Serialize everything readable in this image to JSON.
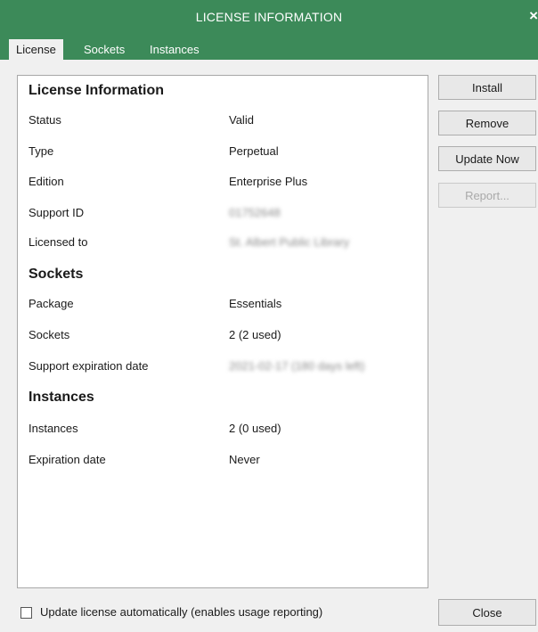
{
  "window": {
    "title": "LICENSE INFORMATION",
    "close_glyph": "×"
  },
  "tabs": [
    {
      "label": "License",
      "active": true
    },
    {
      "label": "Sockets",
      "active": false
    },
    {
      "label": "Instances",
      "active": false
    }
  ],
  "license_info": {
    "heading": "License Information",
    "rows": [
      {
        "label": "Status",
        "value": "Valid"
      },
      {
        "label": "Type",
        "value": "Perpetual"
      },
      {
        "label": "Edition",
        "value": "Enterprise Plus"
      },
      {
        "label": "Support ID",
        "value": "01752648"
      },
      {
        "label": "Licensed to",
        "value": "St. Albert Public Library"
      }
    ]
  },
  "sockets": {
    "heading": "Sockets",
    "rows": [
      {
        "label": "Package",
        "value": "Essentials"
      },
      {
        "label": "Sockets",
        "value": "2 (2 used)"
      },
      {
        "label": "Support expiration date",
        "value": "2021-02-17 (180 days left)"
      }
    ]
  },
  "instances": {
    "heading": "Instances",
    "rows": [
      {
        "label": "Instances",
        "value": "2 (0 used)"
      },
      {
        "label": "Expiration date",
        "value": "Never"
      }
    ]
  },
  "buttons": {
    "install": "Install",
    "remove": "Remove",
    "update_now": "Update Now",
    "report": "Report...",
    "close": "Close"
  },
  "footer": {
    "auto_update_label": "Update license automatically (enables usage reporting)",
    "auto_update_checked": false
  },
  "colors": {
    "titlebar": "#3c8a59",
    "background": "#f0f0f0",
    "panel": "#ffffff"
  }
}
